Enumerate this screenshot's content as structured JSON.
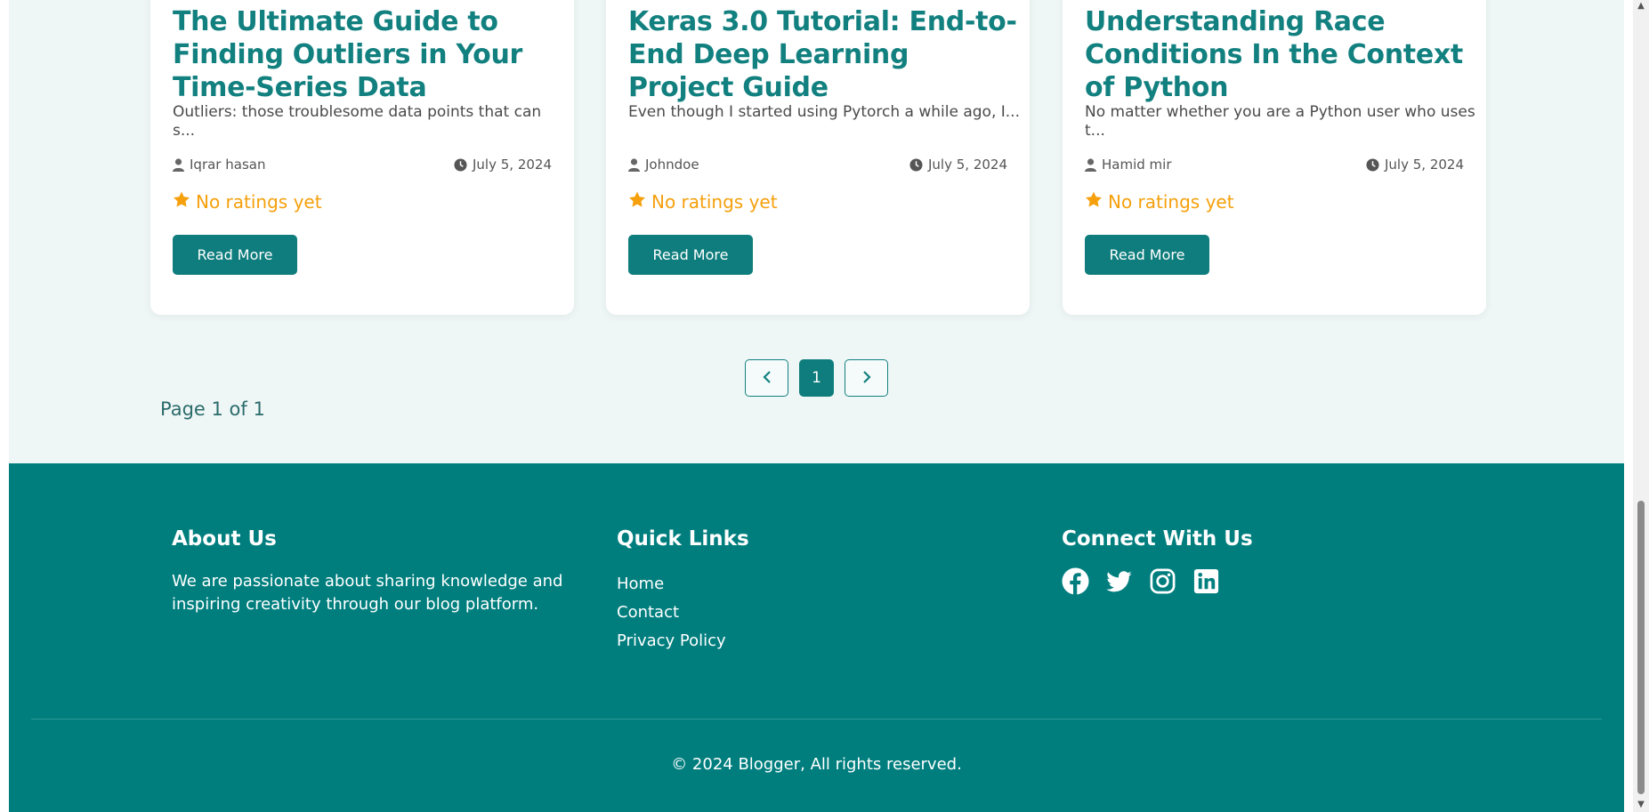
{
  "posts": [
    {
      "title": "The Ultimate Guide to Finding Outliers in Your Time-Series Data",
      "excerpt": "Outliers: those troublesome data points that can s...",
      "author": "Iqrar hasan",
      "date": "July 5, 2024",
      "rating": "No ratings yet",
      "button": "Read More"
    },
    {
      "title": "Keras 3.0 Tutorial: End-to-End Deep Learning Project Guide",
      "excerpt": "Even though I started using Pytorch a while ago, I...",
      "author": "Johndoe",
      "date": "July 5, 2024",
      "rating": "No ratings yet",
      "button": "Read More"
    },
    {
      "title": "Understanding Race Conditions In the Context of Python",
      "excerpt": "No matter whether you are a Python user who uses t...",
      "author": "Hamid mir",
      "date": "July 5, 2024",
      "rating": "No ratings yet",
      "button": "Read More"
    }
  ],
  "pagination": {
    "current": "1",
    "info": "Page 1 of 1"
  },
  "footer": {
    "about": {
      "heading": "About Us",
      "text": "We are passionate about sharing knowledge and inspiring creativity through our blog platform."
    },
    "quick_links": {
      "heading": "Quick Links",
      "items": [
        "Home",
        "Contact",
        "Privacy Policy"
      ]
    },
    "connect": {
      "heading": "Connect With Us",
      "icons": [
        "facebook-icon",
        "twitter-icon",
        "instagram-icon",
        "linkedin-icon"
      ]
    },
    "copyright": "© 2024 Blogger, All rights reserved."
  },
  "colors": {
    "brand": "#0f7d7d",
    "footer_bg": "#007e7e",
    "rating": "#f5a00c",
    "page_bg": "#eff7f6"
  }
}
